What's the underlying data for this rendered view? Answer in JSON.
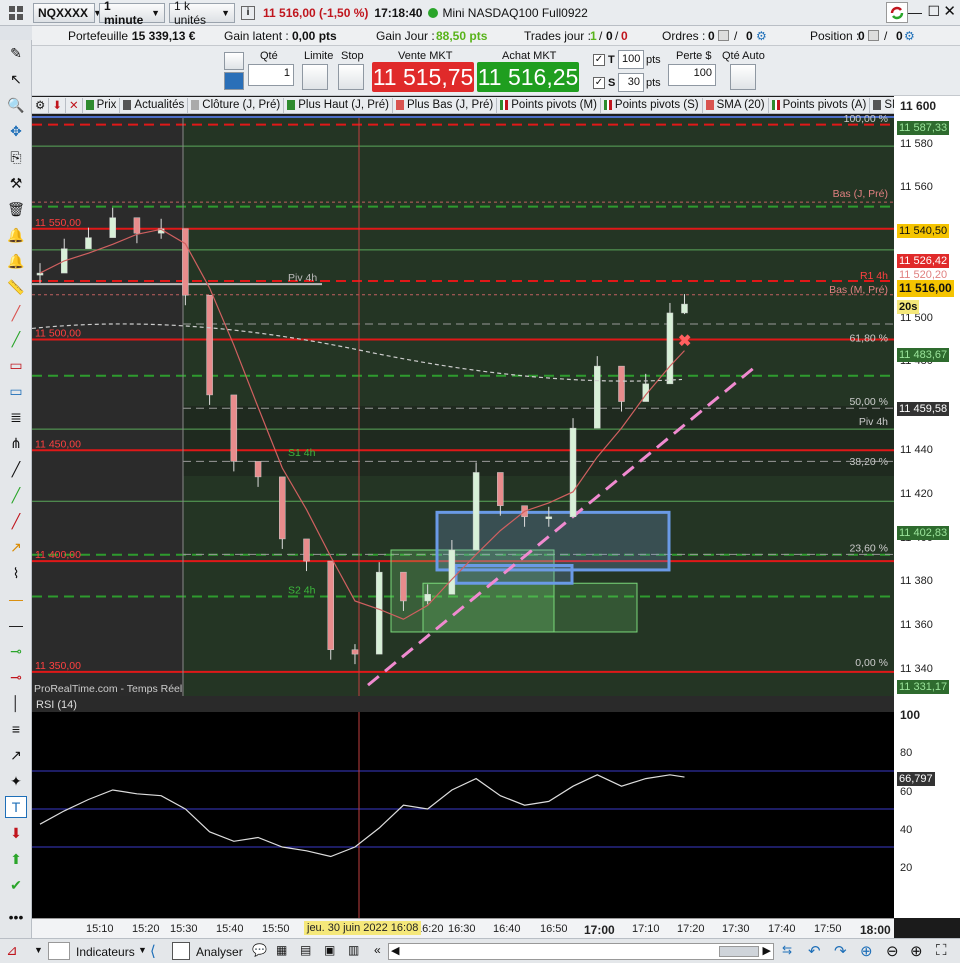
{
  "titlebar": {
    "instrument": "NQXXXX",
    "timeframe": "1 minute",
    "units": "1 k unités",
    "price_info": "11 516,00 (-1,50 %)",
    "time": "17:18:40",
    "instrument_name": "Mini NASDAQ100 Full0922"
  },
  "account": {
    "portfolio_label": "Portefeuille :",
    "portfolio_value": "15 339,13 €",
    "latent_label": "Gain latent :",
    "latent_value": "0,00 pts",
    "day_gain_label": "Gain Jour :",
    "day_gain_value": "88,50 pts",
    "trades_label": "Trades jour :",
    "trades_value1": "1",
    "trades_value2": "0",
    "trades_value3": "0",
    "orders_label": "Ordres :",
    "orders_value1": "0",
    "orders_value2": "0",
    "position_label": "Position :",
    "position_value1": "0",
    "position_value2": "0"
  },
  "order_panel": {
    "qty_label": "Qté",
    "qty_value": "1",
    "limit_label": "Limite",
    "stop_label": "Stop",
    "sell_label": "Vente MKT",
    "sell_price": "11 515,75",
    "buy_label": "Achat MKT",
    "buy_price": "11 516,25",
    "t_label": "T",
    "t_value": "100",
    "t_unit": "pts",
    "s_label": "S",
    "s_value": "30",
    "s_unit": "pts",
    "loss_label": "Perte $",
    "loss_value": "100",
    "auto_qty_label": "Qté Auto"
  },
  "legend": {
    "items": [
      {
        "label": "Prix",
        "color": "#2e8b2e"
      },
      {
        "label": "Actualités",
        "color": "#555555"
      },
      {
        "label": "Clôture (J, Pré)",
        "color": "#aaaaaa"
      },
      {
        "label": "Plus Haut (J, Pré)",
        "color": "#2e8b2e"
      },
      {
        "label": "Plus Bas (J, Pré)",
        "color": "#d9534f"
      },
      {
        "label": "Points pivots (M)",
        "color": "#2e8b2e"
      },
      {
        "label": "Points pivots (S)",
        "color": "#2e8b2e"
      },
      {
        "label": "SMA (20)",
        "color": "#d9534f"
      },
      {
        "label": "Points pivots (A)",
        "color": "#2e8b2e"
      },
      {
        "label": "SMA",
        "color": "#555555"
      }
    ]
  },
  "price_axis": {
    "ticks": [
      "11 600",
      "11 580",
      "11 560",
      "11 540,50",
      "11 520",
      "11 500",
      "11 480",
      "11 460",
      "11 440",
      "11 420",
      "11 400",
      "11 380",
      "11 360",
      "11 340"
    ],
    "boxes": {
      "b1": "11 587,33",
      "b2": "11 540,50",
      "b3": "11 526,42",
      "b4": "11 520,20",
      "current": "11 516,00",
      "countdown": "20s",
      "b5": "11 483,67",
      "b6": "11 459,58",
      "b7": "11 402,83",
      "b8": "11 331,17"
    }
  },
  "chart_annotations": {
    "h1": "11 550,00",
    "h2": "11 500,00",
    "h3": "11 450,00",
    "h4": "11 400,00",
    "h5": "11 350,00",
    "fib100": "100,00 %",
    "fib618": "61,80 %",
    "fib50": "50,00 %",
    "fib382": "38,20 %",
    "fib236": "23,60 %",
    "fib0": "0,00 %",
    "bas_j": "Bas (J, Pré)",
    "r1": "R1 4h",
    "bas_m": "Bas (M, Pré)",
    "piv4h_left": "Piv 4h",
    "piv4h_right": "Piv 4h",
    "s1_4h_a": "S1 4h",
    "s2_4h": "S2 4h",
    "s1_4h": "S1 4h",
    "watermark": "ProRealTime.com - Temps Réel"
  },
  "rsi": {
    "label": "RSI (14)",
    "ticks": [
      "100",
      "80",
      "60",
      "40",
      "20"
    ],
    "current": "66,797"
  },
  "time_axis": {
    "ticks": [
      "15:10",
      "15:20",
      "15:30",
      "15:40",
      "15:50",
      "16:20",
      "16:30",
      "16:40",
      "16:50",
      "17:00",
      "17:10",
      "17:20",
      "17:30",
      "17:40",
      "17:50",
      "18:00"
    ],
    "cursor_label": "jeu. 30 juin 2022 16:08"
  },
  "bottom": {
    "indicators_label": "Indicateurs",
    "analyze_label": "Analyser"
  },
  "chart_data": {
    "type": "line",
    "x": [
      "15:05",
      "15:10",
      "15:15",
      "15:20",
      "15:25",
      "15:30",
      "15:35",
      "15:40",
      "15:45",
      "15:50",
      "15:55",
      "16:00",
      "16:05",
      "16:10",
      "16:15",
      "16:20",
      "16:25",
      "16:30",
      "16:35",
      "16:40",
      "16:45",
      "16:50",
      "16:55",
      "17:00",
      "17:05",
      "17:10",
      "17:15",
      "17:18"
    ],
    "series": [
      {
        "values": [
          11530,
          11541,
          11546,
          11555,
          11548,
          11550,
          11520,
          11475,
          11445,
          11438,
          11410,
          11400,
          11360,
          11358,
          11395,
          11382,
          11385,
          11405,
          11440,
          11425,
          11420,
          11420,
          11460,
          11488,
          11472,
          11480,
          11512,
          11516
        ]
      }
    ],
    "ylim": [
      11340,
      11600
    ],
    "rsi": {
      "x": [
        "15:05",
        "15:10",
        "15:15",
        "15:20",
        "15:25",
        "15:30",
        "15:35",
        "15:40",
        "15:45",
        "15:50",
        "15:55",
        "16:00",
        "16:05",
        "16:10",
        "16:15",
        "16:20",
        "16:25",
        "16:30",
        "16:35",
        "16:40",
        "16:45",
        "16:50",
        "16:55",
        "17:00",
        "17:05",
        "17:10",
        "17:15",
        "17:18"
      ],
      "values": [
        42,
        49,
        55,
        60,
        58,
        57,
        50,
        38,
        33,
        35,
        30,
        28,
        25,
        30,
        40,
        52,
        50,
        60,
        66,
        57,
        52,
        54,
        62,
        68,
        62,
        66,
        68,
        66.8
      ],
      "ylim": [
        0,
        100
      ],
      "levels": [
        30,
        50,
        70
      ]
    }
  }
}
